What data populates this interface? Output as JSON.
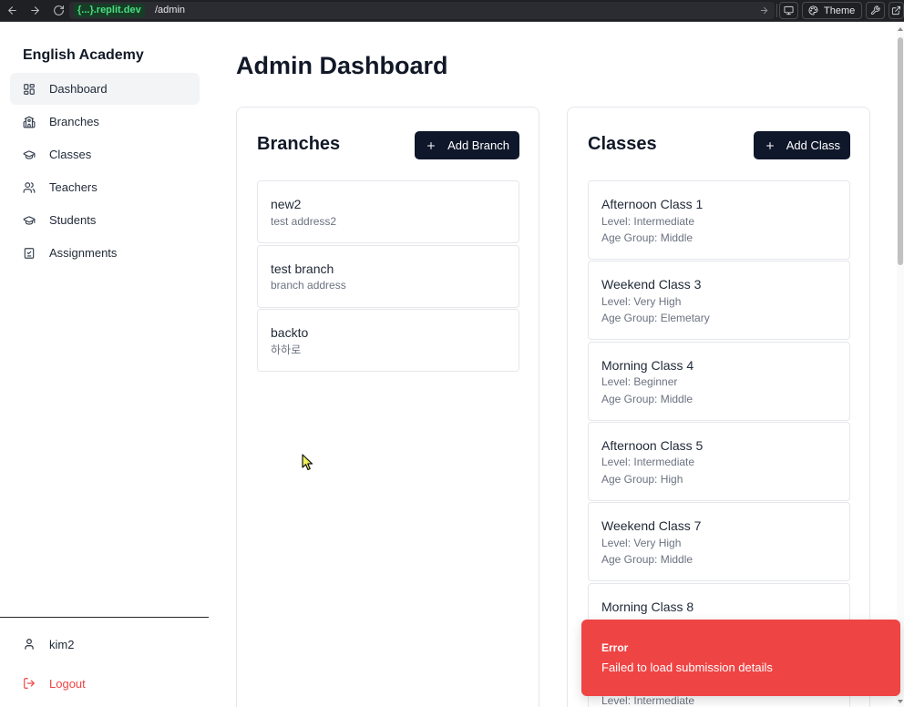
{
  "browser": {
    "domain": "{...}.replit.dev",
    "path": "/admin",
    "theme_label": "Theme",
    "icons": [
      "back-arrow-icon",
      "forward-arrow-icon",
      "reload-icon",
      "arrow-right-icon",
      "monitor-icon",
      "palette-icon",
      "wrench-icon",
      "external-link-icon"
    ]
  },
  "sidebar": {
    "app_title": "English Academy",
    "nav": [
      {
        "label": "Dashboard",
        "icon": "layout-dashboard-icon",
        "active": true
      },
      {
        "label": "Branches",
        "icon": "school-icon",
        "active": false
      },
      {
        "label": "Classes",
        "icon": "graduation-cap-icon",
        "active": false
      },
      {
        "label": "Teachers",
        "icon": "users-icon",
        "active": false
      },
      {
        "label": "Students",
        "icon": "graduation-cap-icon",
        "active": false
      },
      {
        "label": "Assignments",
        "icon": "clipboard-check-icon",
        "active": false
      }
    ],
    "user": {
      "name": "kim2",
      "icon": "user-icon"
    },
    "logout": {
      "label": "Logout",
      "icon": "logout-icon"
    }
  },
  "main": {
    "page_title": "Admin Dashboard",
    "branches": {
      "title": "Branches",
      "add_label": "Add Branch",
      "items": [
        {
          "name": "new2",
          "address": "test address2"
        },
        {
          "name": "test branch",
          "address": "branch address"
        },
        {
          "name": "backto",
          "address": "하하로"
        }
      ]
    },
    "classes": {
      "title": "Classes",
      "add_label": "Add Class",
      "items": [
        {
          "name": "Afternoon Class 1",
          "level": "Level: Intermediate",
          "age_group": "Age Group: Middle"
        },
        {
          "name": "Weekend Class 3",
          "level": "Level: Very High",
          "age_group": "Age Group: Elemetary"
        },
        {
          "name": "Morning Class 4",
          "level": "Level: Beginner",
          "age_group": "Age Group: Middle"
        },
        {
          "name": "Afternoon Class 5",
          "level": "Level: Intermediate",
          "age_group": "Age Group: High"
        },
        {
          "name": "Weekend Class 7",
          "level": "Level: Very High",
          "age_group": "Age Group: Middle"
        },
        {
          "name": "Morning Class 8"
        },
        {
          "level": "Level: Intermediate"
        }
      ]
    }
  },
  "toast": {
    "title": "Error",
    "message": "Failed to load submission details"
  },
  "colors": {
    "primary_button": "#0f172a",
    "active_nav_bg": "#f3f4f6",
    "logout": "#ef4444",
    "toast_bg": "#ef4444",
    "url_domain": "#4ade80",
    "browser_bar": "#1f2024"
  }
}
